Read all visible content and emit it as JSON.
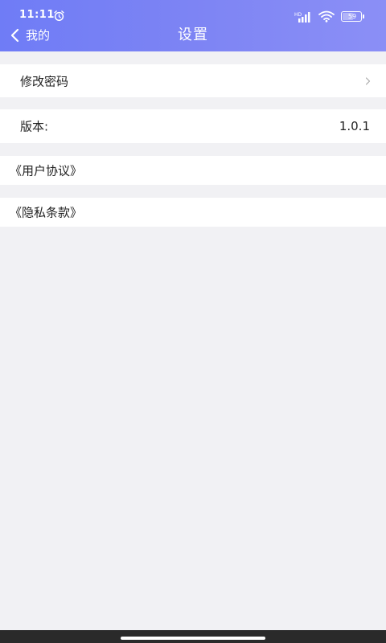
{
  "status_bar": {
    "time": "11:11",
    "network": "HD",
    "battery": "59"
  },
  "header": {
    "back_label": "我的",
    "title": "设置"
  },
  "settings": {
    "change_password": "修改密码",
    "version_label": "版本:",
    "version_value": "1.0.1",
    "user_agreement": "《用户协议》",
    "privacy_policy": "《隐私条款》"
  },
  "colors": {
    "header_gradient_start": "#6f7cf6",
    "header_gradient_end": "#8b8ff6",
    "background": "#f1f1f4"
  },
  "icons": {
    "alarm": "alarm-clock-icon",
    "signal": "cellular-signal-icon",
    "wifi": "wifi-icon",
    "battery": "battery-icon",
    "back": "chevron-left-icon",
    "row_arrow": "chevron-right-icon"
  }
}
